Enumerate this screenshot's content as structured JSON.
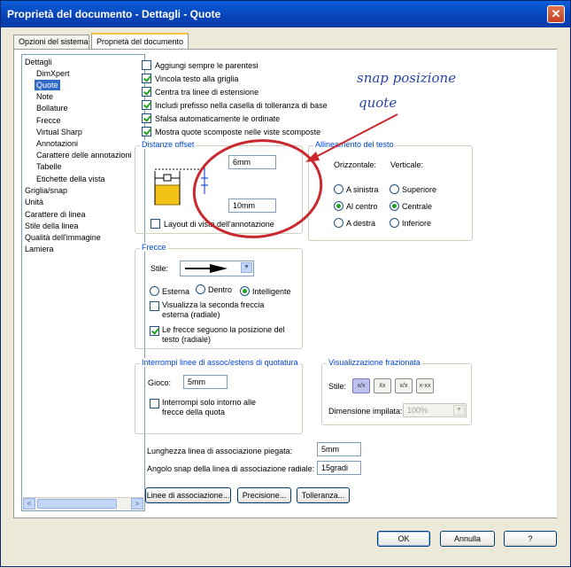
{
  "window": {
    "title": "Proprietà del documento - Dettagli - Quote",
    "close_glyph": "✕"
  },
  "tabs": [
    {
      "label": "Opzioni del sistema"
    },
    {
      "label": "Proprietà del documento"
    }
  ],
  "tree": {
    "items": [
      {
        "label": "Dettagli"
      },
      {
        "label": "DimXpert"
      },
      {
        "label": "Quote"
      },
      {
        "label": "Note"
      },
      {
        "label": "Bollature"
      },
      {
        "label": "Frecce"
      },
      {
        "label": "Virtual Sharp"
      },
      {
        "label": "Annotazioni"
      },
      {
        "label": "Carattere delle annotazioni"
      },
      {
        "label": "Tabelle"
      },
      {
        "label": "Etichette della vista"
      },
      {
        "label": "Griglia/snap"
      },
      {
        "label": "Unità"
      },
      {
        "label": "Carattere di linea"
      },
      {
        "label": "Stile della linea"
      },
      {
        "label": "Qualità dell'immagine"
      },
      {
        "label": "Lamiera"
      }
    ],
    "scroll_left": "<",
    "scroll_right": ">"
  },
  "options": [
    {
      "label": "Aggiungi sempre le parentesi",
      "checked": false
    },
    {
      "label": "Vincola testo alla griglia",
      "checked": true
    },
    {
      "label": "Centra tra linee di estensione",
      "checked": true
    },
    {
      "label": "Includi prefisso nella casella di tolleranza di base",
      "checked": true
    },
    {
      "label": "Sfalsa automaticamente le ordinate",
      "checked": true
    },
    {
      "label": "Mostra quote scomposte nelle viste scomposte",
      "checked": true
    }
  ],
  "offset": {
    "title": "Distanze offset",
    "top_value": "6mm",
    "bottom_value": "10mm",
    "layout_label": "Layout di vista dell'annotazione"
  },
  "alignment": {
    "title": "Allineamento del testo",
    "horizontal_label": "Orizzontale:",
    "vertical_label": "Verticale:",
    "horizontal": [
      {
        "label": "A sinistra",
        "selected": false
      },
      {
        "label": "Al centro",
        "selected": true
      },
      {
        "label": "A destra",
        "selected": false
      }
    ],
    "vertical": [
      {
        "label": "Superiore",
        "selected": false
      },
      {
        "label": "Centrale",
        "selected": true
      },
      {
        "label": "Inferiore",
        "selected": false
      }
    ]
  },
  "arrows": {
    "title": "Frecce",
    "style_label": "Stile:",
    "placement": [
      {
        "label": "Esterna",
        "selected": false
      },
      {
        "label": "Dentro",
        "selected": false
      },
      {
        "label": "Intelligente",
        "selected": true
      }
    ],
    "second_arrow": "Visualizza la seconda freccia esterna (radiale)",
    "second_arrow_checked": false,
    "follow_text": "Le frecce seguono la posizione del testo (radiale)",
    "follow_text_checked": true
  },
  "break": {
    "title": "Interrompi linee di assoc/estens di quotatura",
    "gap_label": "Gioco:",
    "gap_value": "5mm",
    "only_arrows_label": "Interrompi solo intorno alle frecce della quota",
    "only_arrows_checked": false
  },
  "fraction": {
    "title": "Visualizzazione frazionata",
    "style_label": "Stile:",
    "styles": [
      {
        "text": "x/x",
        "on": true
      },
      {
        "text": "x̄x",
        "on": false
      },
      {
        "text": "x/x",
        "on": false
      },
      {
        "text": "x-xx",
        "on": false
      }
    ],
    "stacked_label": "Dimensione impilata:",
    "stacked_value": "100%"
  },
  "bent_leader": {
    "label": "Lunghezza linea di associazione piegata:",
    "value": "5mm"
  },
  "radial_snap": {
    "label": "Angolo snap della linea di associazione radiale:",
    "value": "15gradi"
  },
  "bottom_buttons": [
    "Linee di associazione...",
    "Precisione...",
    "Tolleranza..."
  ],
  "dialog_buttons": {
    "ok": "OK",
    "cancel": "Annulla",
    "help": "?"
  },
  "annotation": {
    "line1": "snap posizione",
    "line2": "quote",
    "color": "#2845a6",
    "circle_color": "#c8282e"
  }
}
